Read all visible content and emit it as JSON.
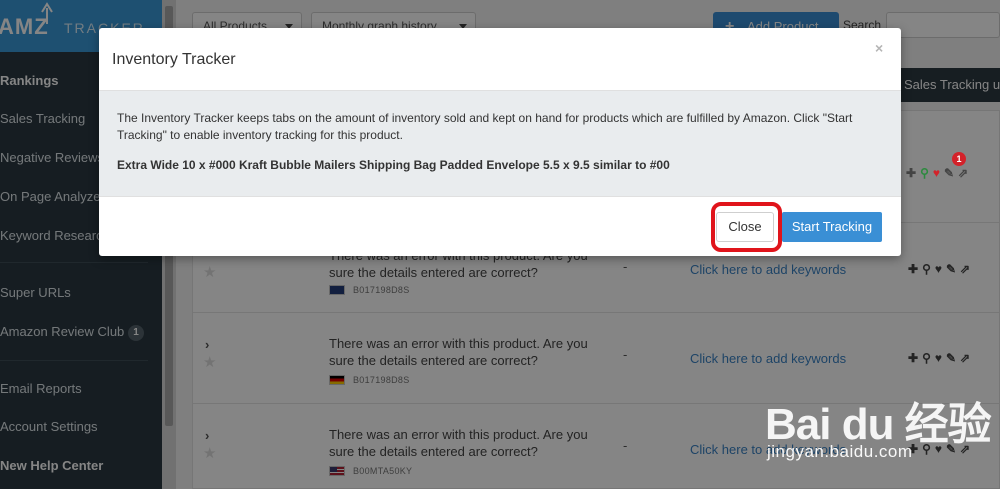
{
  "sidebar": {
    "logo_text": "AMZ",
    "logo_sub": "TRACKER",
    "items": [
      {
        "label": "Rankings"
      },
      {
        "label": "Sales Tracking"
      },
      {
        "label": "Negative Reviews"
      },
      {
        "label": "On Page Analyzer"
      },
      {
        "label": "Keyword Research"
      },
      {
        "label": "Super URLs"
      },
      {
        "label": "Amazon Review Club",
        "badge": "1"
      },
      {
        "label": "Email Reports"
      },
      {
        "label": "Account Settings"
      },
      {
        "label": "New Help Center"
      }
    ]
  },
  "toolbar": {
    "filter_select": "All Products",
    "graph_select": "Monthly graph history",
    "add_product_label": "Add Product",
    "search_label": "Search"
  },
  "banner": {
    "text": "Sales Tracking up"
  },
  "products": [
    {
      "error": "There was an error with this product. Are you sure the details entered are correct?",
      "asin": "B017198D8S",
      "flag": "uk",
      "dash": "-",
      "keywords_link": "Click here to add keywords"
    },
    {
      "error": "There was an error with this product. Are you sure the details entered are correct?",
      "asin": "B017198D8S",
      "flag": "de",
      "dash": "-",
      "keywords_link": "Click here to add keywords"
    },
    {
      "error": "There was an error with this product. Are you sure the details entered are correct?",
      "asin": "B00MTA50KY",
      "flag": "us",
      "dash": "-",
      "keywords_link": "Click here to add keywords"
    }
  ],
  "favorites_badge": "1",
  "modal": {
    "title": "Inventory Tracker",
    "close_x": "×",
    "description": "The Inventory Tracker keeps tabs on the amount of inventory sold and kept on hand for products which are fulfilled by Amazon. Click \"Start Tracking\" to enable inventory tracking for this product.",
    "product_name": "Extra Wide 10 x #000 Kraft Bubble Mailers Shipping Bag Padded Envelope 5.5 x 9.5 similar to #00",
    "close_button": "Close",
    "start_button": "Start Tracking"
  },
  "watermark": {
    "brand": "Bai du 经验",
    "url": "jingyan.baidu.com"
  },
  "colors": {
    "accent": "#3a8fd5",
    "sidebar_bg": "#2b3942",
    "highlight": "#e0141b",
    "link": "#3a83c5"
  }
}
